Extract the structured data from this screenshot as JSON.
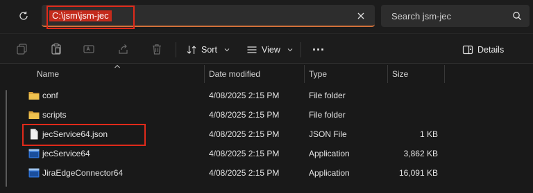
{
  "address_bar": {
    "path": "C:\\jsm\\jsm-jec"
  },
  "search": {
    "placeholder": "Search jsm-jec"
  },
  "toolbar": {
    "sort_label": "Sort",
    "view_label": "View",
    "more_label": "...",
    "details_label": "Details"
  },
  "columns": {
    "name": "Name",
    "date": "Date modified",
    "type": "Type",
    "size": "Size"
  },
  "files": [
    {
      "name": "conf",
      "date": "4/08/2025 2:15 PM",
      "type": "File folder",
      "size": "",
      "icon": "folder-icon"
    },
    {
      "name": "scripts",
      "date": "4/08/2025 2:15 PM",
      "type": "File folder",
      "size": "",
      "icon": "folder-icon"
    },
    {
      "name": "jecService64.json",
      "date": "4/08/2025 2:15 PM",
      "type": "JSON File",
      "size": "1 KB",
      "icon": "file-icon"
    },
    {
      "name": "jecService64",
      "date": "4/08/2025 2:15 PM",
      "type": "Application",
      "size": "3,862 KB",
      "icon": "application-icon"
    },
    {
      "name": "JiraEdgeConnector64",
      "date": "4/08/2025 2:15 PM",
      "type": "Application",
      "size": "16,091 KB",
      "icon": "application-icon"
    }
  ],
  "colors": {
    "accent": "#d2713a",
    "highlight": "#c42b1c",
    "annotation": "#e02a1a",
    "folder": "#e8b64a"
  }
}
